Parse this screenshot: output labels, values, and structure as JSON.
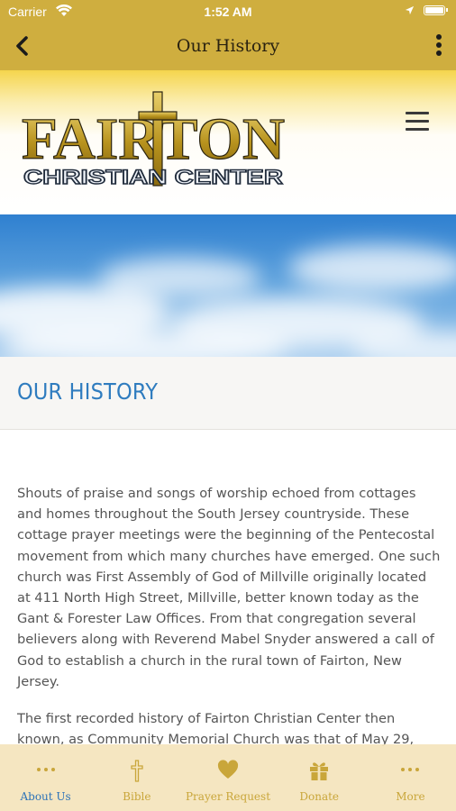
{
  "status_bar": {
    "carrier": "Carrier",
    "time": "1:52 AM"
  },
  "nav": {
    "title": "Our History"
  },
  "logo": {
    "line1": "FAIRTON",
    "line2": "CHRISTIAN CENTER"
  },
  "page": {
    "heading": "OUR HISTORY",
    "paragraphs": [
      "Shouts of praise and songs of worship echoed from cottages and homes throughout the South Jersey countryside. These cottage prayer meetings were the beginning of the Pentecostal movement from which many churches have emerged. One such church was First Assembly of God of Millville originally located at 411 North High Street, Millville, better known today as the Gant & Forester Law Offices. From that congregation several believers along with Reverend Mabel Snyder answered a call of God to establish a church in the rural town of Fairton, New Jersey.",
      "The first recorded history of Fairton Christian Center then known, as Community Memorial Church was that of May 29,"
    ]
  },
  "tabs": [
    {
      "label": "About Us",
      "icon": "more-dots-icon",
      "active": true
    },
    {
      "label": "Bible",
      "icon": "cross-icon",
      "active": false
    },
    {
      "label": "Prayer Request",
      "icon": "heart-icon",
      "active": false
    },
    {
      "label": "Donate",
      "icon": "gift-icon",
      "active": false
    },
    {
      "label": "More",
      "icon": "more-dots-icon",
      "active": false
    }
  ],
  "colors": {
    "nav_gold": "#cfae3f",
    "heading_blue": "#2f7cbf",
    "tab_gold": "#c9a63a",
    "tab_active": "#2d73b8"
  }
}
